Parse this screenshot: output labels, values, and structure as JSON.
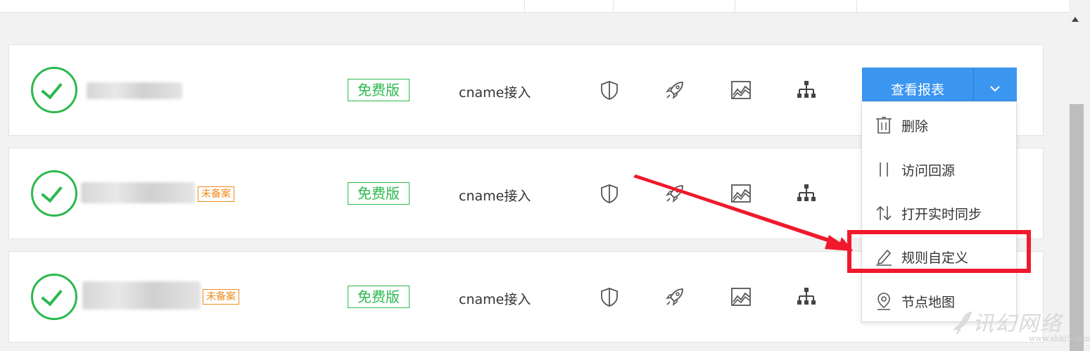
{
  "rows": [
    {
      "domain_hidden": true,
      "beian_tag": "",
      "plan_label": "免费版",
      "access_mode": "cname接入",
      "icons": [
        "shield-icon",
        "rocket-icon",
        "stats-chart-icon",
        "node-tree-icon"
      ]
    },
    {
      "domain_hidden": true,
      "beian_tag": "未备案",
      "plan_label": "免费版",
      "access_mode": "cname接入",
      "icons": [
        "shield-icon",
        "rocket-icon",
        "stats-chart-icon",
        "node-tree-icon"
      ]
    },
    {
      "domain_hidden": true,
      "beian_tag": "未备案",
      "plan_label": "免费版",
      "access_mode": "cname接入",
      "icons": [
        "shield-icon",
        "rocket-icon",
        "stats-chart-icon",
        "node-tree-icon"
      ]
    }
  ],
  "report_button": {
    "label": "查看报表",
    "caret_icon": "chevron-down-icon"
  },
  "dropdown_menu": [
    {
      "label": "删除",
      "icon": "trash-icon"
    },
    {
      "label": "访问回源",
      "icon": "back-to-origin-icon"
    },
    {
      "label": "打开实时同步",
      "icon": "sync-arrows-icon"
    },
    {
      "label": "规则自定义",
      "icon": "pencil-icon",
      "highlighted": true
    },
    {
      "label": "节点地图",
      "icon": "map-pin-icon"
    }
  ],
  "watermark": {
    "text": "讯幻网络",
    "url": "www.xhkj5.com"
  },
  "colors": {
    "accent_blue": "#3b96f0",
    "success_green": "#2cb84e",
    "warning_orange": "#f08a1c",
    "highlight_red": "#f0192d"
  }
}
